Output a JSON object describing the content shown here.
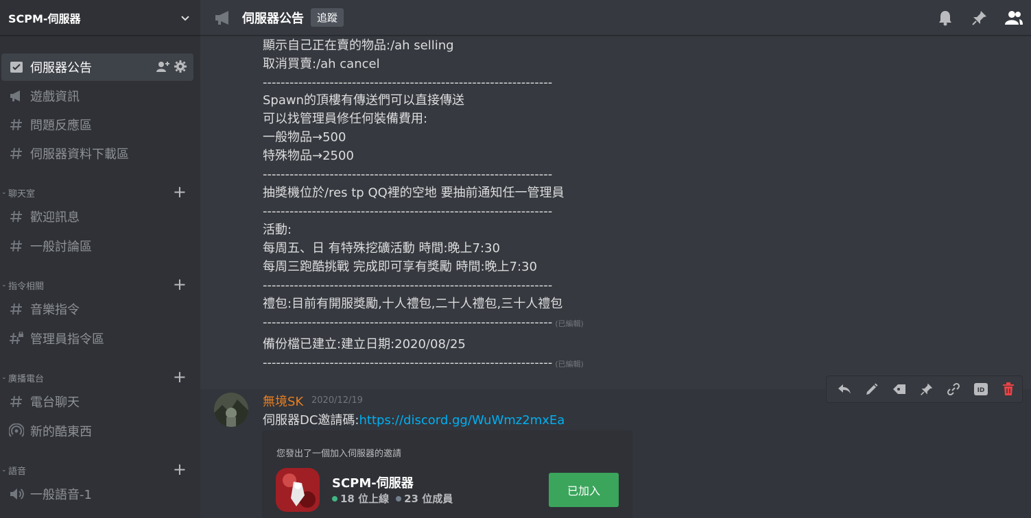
{
  "server": {
    "name": "SCPM-伺服器"
  },
  "sidebar": {
    "channels": [
      {
        "label": "伺服器公告",
        "icon": "announcement-icon"
      },
      {
        "label": "遊戲資訊",
        "icon": "announcement-icon"
      },
      {
        "label": "問題反應區",
        "icon": "hash-icon"
      },
      {
        "label": "伺服器資料下載區",
        "icon": "hash-icon"
      }
    ],
    "categories": [
      {
        "label": "聊天室",
        "channels": [
          {
            "label": "歡迎訊息",
            "icon": "hash-icon"
          },
          {
            "label": "一般討論區",
            "icon": "hash-icon"
          }
        ]
      },
      {
        "label": "指令相關",
        "channels": [
          {
            "label": "音樂指令",
            "icon": "hash-icon"
          },
          {
            "label": "管理員指令區",
            "icon": "locked-hash-icon"
          }
        ]
      },
      {
        "label": "廣播電台",
        "channels": [
          {
            "label": "電台聊天",
            "icon": "hash-icon"
          },
          {
            "label": "新的酷東西",
            "icon": "broadcast-icon"
          }
        ]
      },
      {
        "label": "語音",
        "channels": [
          {
            "label": "一般語音-1",
            "icon": "speaker-icon"
          }
        ]
      }
    ]
  },
  "header": {
    "channel_title": "伺服器公告",
    "follow_label": "追蹤"
  },
  "messages": {
    "announcement_lines": [
      "顯示自己正在賣的物品:/ah selling",
      "取消買賣:/ah cancel",
      "-----------------------------------------------------------------",
      "Spawn的頂樓有傳送們可以直接傳送",
      "可以找管理員修任何裝備費用:",
      "一般物品→500",
      "特殊物品→2500",
      "-----------------------------------------------------------------",
      "抽獎機位於/res tp QQ裡的空地 要抽前通知任一管理員",
      "-----------------------------------------------------------------",
      "活動:",
      "每周五、日 有特殊挖礦活動 時間:晚上7:30",
      "每周三跑酷挑戰 完成即可享有獎勵 時間:晚上7:30",
      "-----------------------------------------------------------------",
      "禮包:目前有開服獎勵,十人禮包,二十人禮包,三十人禮包",
      "-----------------------------------------------------------------",
      "備份檔已建立:建立日期:2020/08/25",
      "-----------------------------------------------------------------"
    ],
    "edited_label": "(已編輯)",
    "second": {
      "username": "無境SK",
      "timestamp": "2020/12/19",
      "text": "伺服器DC邀請碼:",
      "link": "https://discord.gg/WuWmz2mxEa",
      "invite": {
        "header": "您發出了一個加入伺服器的邀請",
        "server_name": "SCPM-伺服器",
        "online": "18 位上線",
        "members": "23 位成員",
        "button": "已加入"
      }
    }
  },
  "colors": {
    "username": "#e67e22",
    "link": "#00b0f4",
    "joined": "#3ba55c",
    "delete": "#ed4245"
  }
}
